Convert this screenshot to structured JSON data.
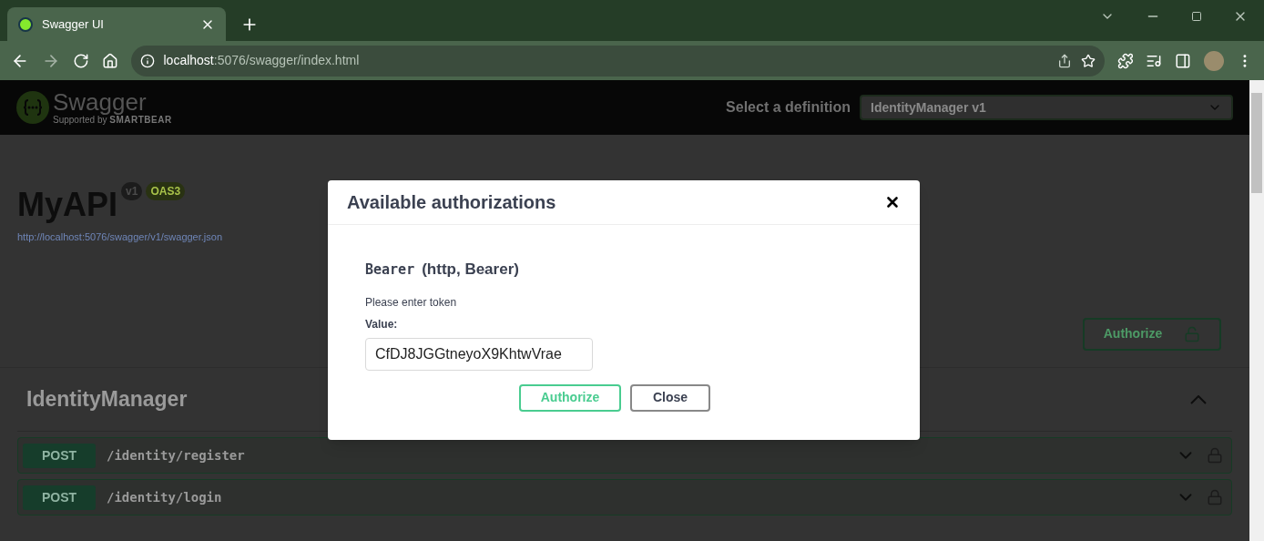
{
  "browser": {
    "tab": {
      "title": "Swagger UI"
    },
    "url": {
      "host": "localhost",
      "path": ":5076/swagger/index.html"
    }
  },
  "header": {
    "logo": {
      "name": "Swagger",
      "tagline_prefix": "Supported by",
      "tagline_brand": "SMARTBEAR"
    },
    "definition": {
      "label": "Select a definition",
      "selected": "IdentityManager v1"
    }
  },
  "info": {
    "title": "MyAPI",
    "version": "v1",
    "spec": "OAS3",
    "link": "http://localhost:5076/swagger/v1/swagger.json",
    "authorize_button": "Authorize"
  },
  "section": {
    "title": "IdentityManager",
    "expanded": true,
    "operations": [
      {
        "method": "POST",
        "path": "/identity/register"
      },
      {
        "method": "POST",
        "path": "/identity/login"
      }
    ]
  },
  "modal": {
    "title": "Available authorizations",
    "scheme": {
      "name": "Bearer",
      "type": "(http, Bearer)"
    },
    "hint": "Please enter token",
    "value_label": "Value:",
    "value": "CfDJ8JGGtneyoX9KhtwVrae",
    "buttons": {
      "authorize": "Authorize",
      "close": "Close"
    }
  }
}
